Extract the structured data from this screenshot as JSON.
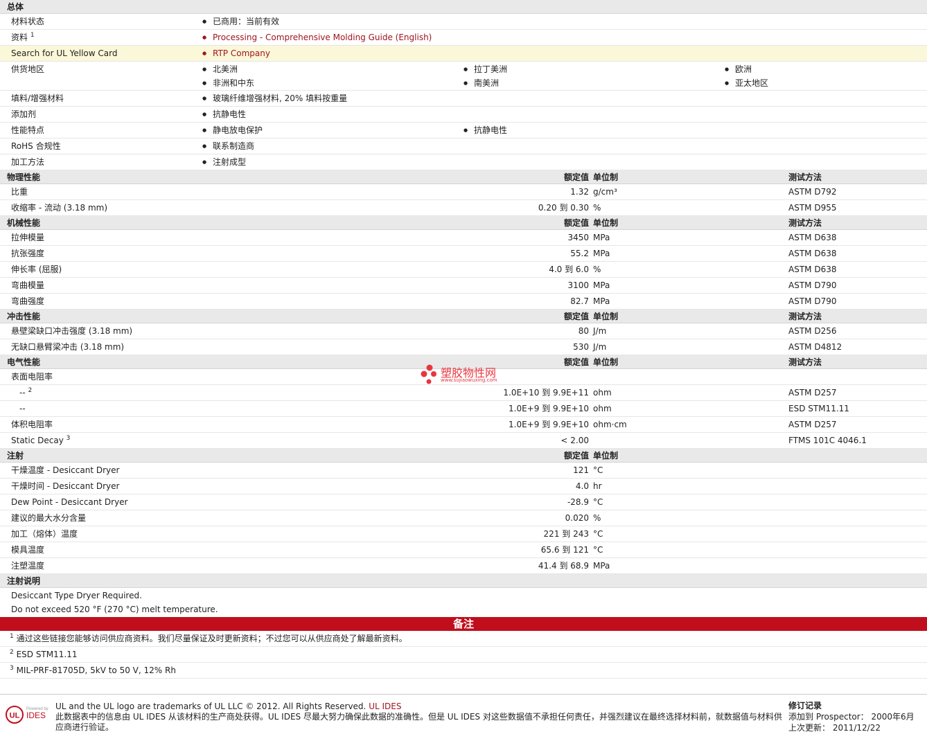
{
  "sections": {
    "general": "总体",
    "physical": "物理性能",
    "mechanical": "机械性能",
    "impact": "冲击性能",
    "electrical": "电气性能",
    "injection": "注射",
    "injection_notes": "注射说明"
  },
  "col_headers": {
    "value": "额定值",
    "unit": "单位制",
    "method": "测试方法"
  },
  "general": {
    "status_label": "材料状态",
    "status_value": "已商用：当前有效",
    "source_label": "资料",
    "source_sup": "1",
    "source_link": "Processing - Comprehensive Molding Guide (English)",
    "ul_label": "Search for UL Yellow Card",
    "ul_link": "RTP Company",
    "supply_label": "供货地区",
    "supply": [
      "北美洲",
      "拉丁美洲",
      "欧洲",
      "非洲和中东",
      "南美洲",
      "亚太地区"
    ],
    "filler_label": "填料/增强材料",
    "filler_value": "玻璃纤维增强材料, 20% 填料按重量",
    "additive_label": "添加剂",
    "additive_value": "抗静电性",
    "features_label": "性能特点",
    "features": [
      "静电放电保护",
      "抗静电性"
    ],
    "rohs_label": "RoHS 合规性",
    "rohs_value": "联系制造商",
    "process_label": "加工方法",
    "process_value": "注射成型"
  },
  "physical": [
    {
      "name": "比重",
      "value": "1.32",
      "unit": "g/cm³",
      "method": "ASTM D792"
    },
    {
      "name": "收缩率  - 流动  (3.18 mm)",
      "value": "0.20 到  0.30",
      "unit": "%",
      "method": "ASTM D955"
    }
  ],
  "mechanical": [
    {
      "name": "拉伸模量",
      "value": "3450",
      "unit": "MPa",
      "method": "ASTM D638"
    },
    {
      "name": "抗张强度",
      "value": "55.2",
      "unit": "MPa",
      "method": "ASTM D638"
    },
    {
      "name": "伸长率  (屈服)",
      "value": "4.0 到  6.0",
      "unit": "%",
      "method": "ASTM D638"
    },
    {
      "name": "弯曲模量",
      "value": "3100",
      "unit": "MPa",
      "method": "ASTM D790"
    },
    {
      "name": "弯曲强度",
      "value": "82.7",
      "unit": "MPa",
      "method": "ASTM D790"
    }
  ],
  "impact": [
    {
      "name": "悬壁梁缺口冲击强度  (3.18 mm)",
      "value": "80",
      "unit": "J/m",
      "method": "ASTM D256"
    },
    {
      "name": "无缺口悬臂梁冲击  (3.18 mm)",
      "value": "530",
      "unit": "J/m",
      "method": "ASTM D4812"
    }
  ],
  "electrical": {
    "surface_label": "表面电阻率",
    "surface_rows": [
      {
        "name": "--",
        "sup": "2",
        "value": "1.0E+10 到  9.9E+11",
        "unit": "ohm",
        "method": "ASTM D257"
      },
      {
        "name": "--",
        "sup": "",
        "value": "1.0E+9 到  9.9E+10",
        "unit": "ohm",
        "method": "ESD STM11.11"
      }
    ],
    "rows": [
      {
        "name": "体积电阻率",
        "sup": "",
        "value": "1.0E+9 到  9.9E+10",
        "unit": "ohm·cm",
        "method": "ASTM D257"
      },
      {
        "name": "Static Decay",
        "sup": "3",
        "value": "< 2.00",
        "unit": "",
        "method": "FTMS 101C 4046.1"
      }
    ]
  },
  "injection": [
    {
      "name": "干燥温度  - Desiccant Dryer",
      "value": "121",
      "unit": "°C"
    },
    {
      "name": "干燥时间  - Desiccant Dryer",
      "value": "4.0",
      "unit": "hr"
    },
    {
      "name": "Dew Point - Desiccant Dryer",
      "value": "-28.9",
      "unit": "°C"
    },
    {
      "name": "建议的最大水分含量",
      "value": "0.020",
      "unit": "%"
    },
    {
      "name": "加工（熔体）温度",
      "value": "221 到  243",
      "unit": "°C"
    },
    {
      "name": "模具温度",
      "value": "65.6 到  121",
      "unit": "°C"
    },
    {
      "name": "注塑温度",
      "value": "41.4 到  68.9",
      "unit": "MPa"
    }
  ],
  "injection_notes": [
    "Desiccant Type Dryer Required.",
    "Do not exceed 520 °F (270 °C) melt temperature."
  ],
  "notes_title": "备注",
  "footnotes": [
    {
      "sup": "1",
      "text": "通过这些链接您能够访问供应商资料。我们尽量保证及时更新资料；不过您可以从供应商处了解最新资料。"
    },
    {
      "sup": "2",
      "text": "ESD STM11.11"
    },
    {
      "sup": "3",
      "text": "MIL-PRF-81705D, 5kV to 50 V, 12% Rh"
    }
  ],
  "footer": {
    "trademark": "UL and the UL logo are trademarks of UL LLC © 2012. All Rights Reserved.",
    "ul_ides_link": "UL IDES",
    "disclaimer": "此数据表中的信息由  UL IDES 从该材料的生产商处获得。UL IDES 尽最大努力确保此数据的准确性。但是  UL IDES 对这些数据值不承担任何责任，并强烈建议在最终选择材料前，就数据值与材料供应商进行验证。",
    "logo_powered": "Powered by",
    "logo_ides": "IDES",
    "logo_ul": "UL",
    "rev_title": "修订记录",
    "rev_added": "添加到  Prospector：  2000年6月",
    "rev_updated": "上次更新：  2011/12/22"
  },
  "watermark": {
    "text": "塑胶物性网",
    "url": "www.sujiaowuxing.com"
  },
  "colors": {
    "accent": "#c00e1d",
    "link": "#a0141e",
    "header_bg": "#e9e9e9",
    "highlight_bg": "#fbf7d9"
  }
}
